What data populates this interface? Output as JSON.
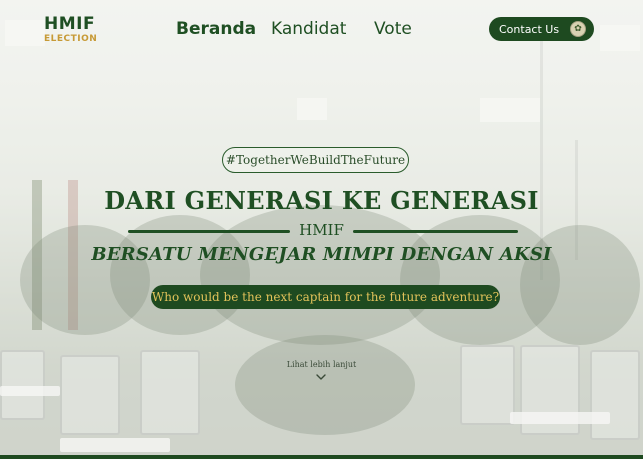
{
  "brand": {
    "title": "HMIF",
    "subtitle": "ELECTION"
  },
  "nav": {
    "items": [
      {
        "label": "Beranda",
        "active": true
      },
      {
        "label": "Kandidat",
        "active": false
      },
      {
        "label": "Vote",
        "active": false
      }
    ],
    "contact_label": "Contact Us",
    "contact_icon": "emblem-icon"
  },
  "hero": {
    "hashtag": "#TogetherWeBuildTheFuture",
    "headline": "DARI GENERASI KE GENERASI",
    "org": "HMIF",
    "tagline": "BERSATU MENGEJAR MIMPI DENGAN AKSI",
    "question": "Who would be the next captain for the future adventure?",
    "more_label": "Lihat lebih lanjut"
  },
  "colors": {
    "primary": "#1f4f23",
    "accent": "#c79a36",
    "question_text": "#e2c25a"
  }
}
